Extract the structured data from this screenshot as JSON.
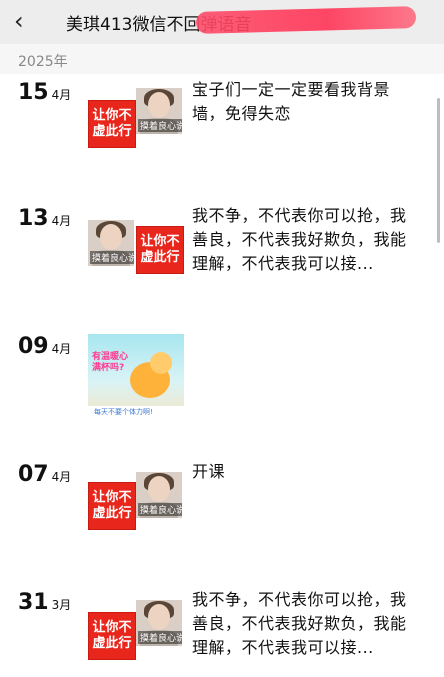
{
  "header": {
    "title": "美琪413微信不回弹语音",
    "back_icon": "chevron-left"
  },
  "year_label": "2025年",
  "entries": [
    {
      "day": "15",
      "month": "4月",
      "red_label": "让你不虚此行",
      "photo_caption": "摸着良心说",
      "text": "宝子们一定一定要看我背景墙，免得失恋"
    },
    {
      "day": "13",
      "month": "4月",
      "red_label": "让你不虚此行",
      "photo_caption": "摸着良心说",
      "text": "我不争，不代表你可以抢，我善良，不代表我好欺负，我能理解，不代表我可以接..."
    },
    {
      "day": "09",
      "month": "4月",
      "poster_text": "有温暖心满杯吗?",
      "poster_caption": "每天不要个体力啊!"
    },
    {
      "day": "07",
      "month": "4月",
      "red_label": "让你不虚此行",
      "photo_caption": "摸着良心说",
      "text": "开课"
    },
    {
      "day": "31",
      "month": "3月",
      "red_label": "让你不虚此行",
      "photo_caption": "摸着良心说",
      "text": "我不争，不代表你可以抢，我善良，不代表我好欺负，我能理解，不代表我可以接..."
    }
  ]
}
